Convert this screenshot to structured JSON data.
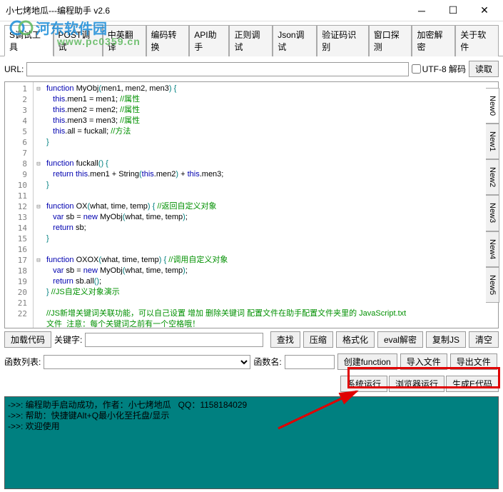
{
  "window": {
    "title": "小七烤地瓜---编程助手 v2.6"
  },
  "watermark": {
    "text_cn": "河东软件园",
    "url": "www.pc0359.cn"
  },
  "tabs": {
    "items": [
      "S调试工具",
      "POST调试",
      "中英翻译",
      "编码转换",
      "API助手",
      "正则调试",
      "Json调试",
      "验证码识别",
      "窗口探测",
      "加密解密",
      "关于软件"
    ],
    "active": 0
  },
  "url_row": {
    "label": "URL:",
    "value": "",
    "utf8_label": "UTF-8 解码",
    "read_btn": "读取"
  },
  "code": {
    "lines": [
      {
        "n": 1,
        "fold": true,
        "html": "<span class='kw'>function</span> <span class='plain'>MyObj</span><span class='paren'>(</span><span class='plain'>men1, men2, men3</span><span class='paren'>)</span> <span class='paren'>{</span>"
      },
      {
        "n": 2,
        "html": "   <span class='kw'>this</span><span class='plain'>.men1 </span><span class='plain'>=</span><span class='plain'> men1; </span><span class='comm'>//属性</span>"
      },
      {
        "n": 3,
        "html": "   <span class='kw'>this</span><span class='plain'>.men2 </span><span class='plain'>=</span><span class='plain'> men2; </span><span class='comm'>//属性</span>"
      },
      {
        "n": 4,
        "html": "   <span class='kw'>this</span><span class='plain'>.men3 </span><span class='plain'>=</span><span class='plain'> men3; </span><span class='comm'>//属性</span>"
      },
      {
        "n": 5,
        "html": "   <span class='kw'>this</span><span class='plain'>.all </span><span class='plain'>=</span><span class='plain'> fuckall; </span><span class='comm'>//方法</span>"
      },
      {
        "n": 6,
        "html": "<span class='paren'>}</span>"
      },
      {
        "n": 7,
        "html": ""
      },
      {
        "n": 8,
        "fold": true,
        "html": "<span class='kw'>function</span> <span class='plain'>fuckall</span><span class='paren'>()</span> <span class='paren'>{</span>"
      },
      {
        "n": 9,
        "html": "   <span class='kw'>return</span> <span class='kw'>this</span><span class='plain'>.men1 </span><span class='plain'>+</span><span class='plain'> String</span><span class='paren'>(</span><span class='kw'>this</span><span class='plain'>.men2</span><span class='paren'>)</span> <span class='plain'>+</span> <span class='kw'>this</span><span class='plain'>.men3;</span>"
      },
      {
        "n": 10,
        "html": "<span class='paren'>}</span>"
      },
      {
        "n": 11,
        "html": ""
      },
      {
        "n": 12,
        "fold": true,
        "html": "<span class='kw'>function</span> <span class='plain'>OX</span><span class='paren'>(</span><span class='plain'>what, time, temp</span><span class='paren'>)</span> <span class='paren'>{</span> <span class='comm'>//返回自定义对象</span>"
      },
      {
        "n": 13,
        "html": "   <span class='kw'>var</span> <span class='plain'>sb </span><span class='plain'>=</span> <span class='kw'>new</span> <span class='plain'>MyObj</span><span class='paren'>(</span><span class='plain'>what, time, temp</span><span class='paren'>)</span><span class='plain'>;</span>"
      },
      {
        "n": 14,
        "html": "   <span class='kw'>return</span> <span class='plain'>sb;</span>"
      },
      {
        "n": 15,
        "html": "<span class='paren'>}</span>"
      },
      {
        "n": 16,
        "html": ""
      },
      {
        "n": 17,
        "fold": true,
        "html": "<span class='kw'>function</span> <span class='plain'>OXOX</span><span class='paren'>(</span><span class='plain'>what, time, temp</span><span class='paren'>)</span> <span class='paren'>{</span> <span class='comm'>//调用自定义对象</span>"
      },
      {
        "n": 18,
        "html": "   <span class='kw'>var</span> <span class='plain'>sb </span><span class='plain'>=</span> <span class='kw'>new</span> <span class='plain'>MyObj</span><span class='paren'>(</span><span class='plain'>what, time, temp</span><span class='paren'>)</span><span class='plain'>;</span>"
      },
      {
        "n": 19,
        "html": "   <span class='kw'>return</span> <span class='plain'>sb.all</span><span class='paren'>()</span><span class='plain'>;</span>"
      },
      {
        "n": 20,
        "html": "<span class='paren'>}</span> <span class='comm'>//JS自定义对象演示</span>"
      },
      {
        "n": 21,
        "html": ""
      },
      {
        "n": 22,
        "html": "<span class='comm'>//JS新增关键词关联功能，可以自己设置 增加 删除关键词 配置文件在助手配置文件夹里的 JavaScript.txt</span>"
      },
      {
        "n": 23,
        "hide_num": true,
        "html": "<span class='comm'>文件  注意：每个关键词之前有一个空格哦！</span>"
      }
    ],
    "side_tabs": [
      "New0",
      "New1",
      "New2",
      "New3",
      "New4",
      "New5"
    ]
  },
  "toolbar1": {
    "load_code": "加载代码",
    "keyword_label": "关键字:",
    "keyword_value": "",
    "find": "查找",
    "compress": "压缩",
    "format": "格式化",
    "eval": "eval解密",
    "copy": "复制JS",
    "clear": "清空"
  },
  "toolbar2": {
    "func_list_label": "函数列表:",
    "func_list_value": "",
    "func_name_label": "函数名:",
    "func_name_value": "",
    "create_func": "创建function",
    "import_file": "导入文件",
    "export_file": "导出文件"
  },
  "run_row": {
    "sys_run": "系统运行",
    "browser_run": "浏览器运行",
    "gen_ecode": "生成E代码"
  },
  "console": {
    "lines": [
      "->>: 编程助手启动成功，作者：小七烤地瓜   QQ：1158184029",
      "->>: 帮助：快捷键Alt+Q最小化至托盘/显示",
      "->>: 欢迎使用"
    ]
  }
}
